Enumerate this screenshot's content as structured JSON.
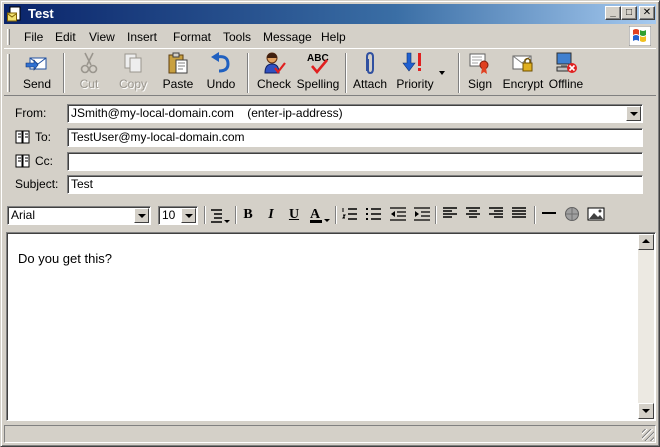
{
  "window": {
    "title": "Test"
  },
  "menu": [
    "File",
    "Edit",
    "View",
    "Insert",
    "Format",
    "Tools",
    "Message",
    "Help"
  ],
  "toolbar": {
    "send": "Send",
    "cut": "Cut",
    "copy": "Copy",
    "paste": "Paste",
    "undo": "Undo",
    "check": "Check",
    "spelling": "Spelling",
    "attach": "Attach",
    "priority": "Priority",
    "sign": "Sign",
    "encrypt": "Encrypt",
    "offline": "Offline"
  },
  "header": {
    "from_label": "From:",
    "from_value": "JSmith@my-local-domain.com    (enter-ip-address)",
    "to_label": "To:",
    "to_value": "TestUser@my-local-domain.com",
    "cc_label": "Cc:",
    "cc_value": "",
    "subject_label": "Subject:",
    "subject_value": "Test"
  },
  "format": {
    "font": "Arial",
    "size": "10"
  },
  "body": {
    "text": "Do you get this?"
  },
  "colors": {
    "title_start": "#0a246a",
    "title_end": "#a6caf0",
    "face": "#d4d0c8"
  }
}
